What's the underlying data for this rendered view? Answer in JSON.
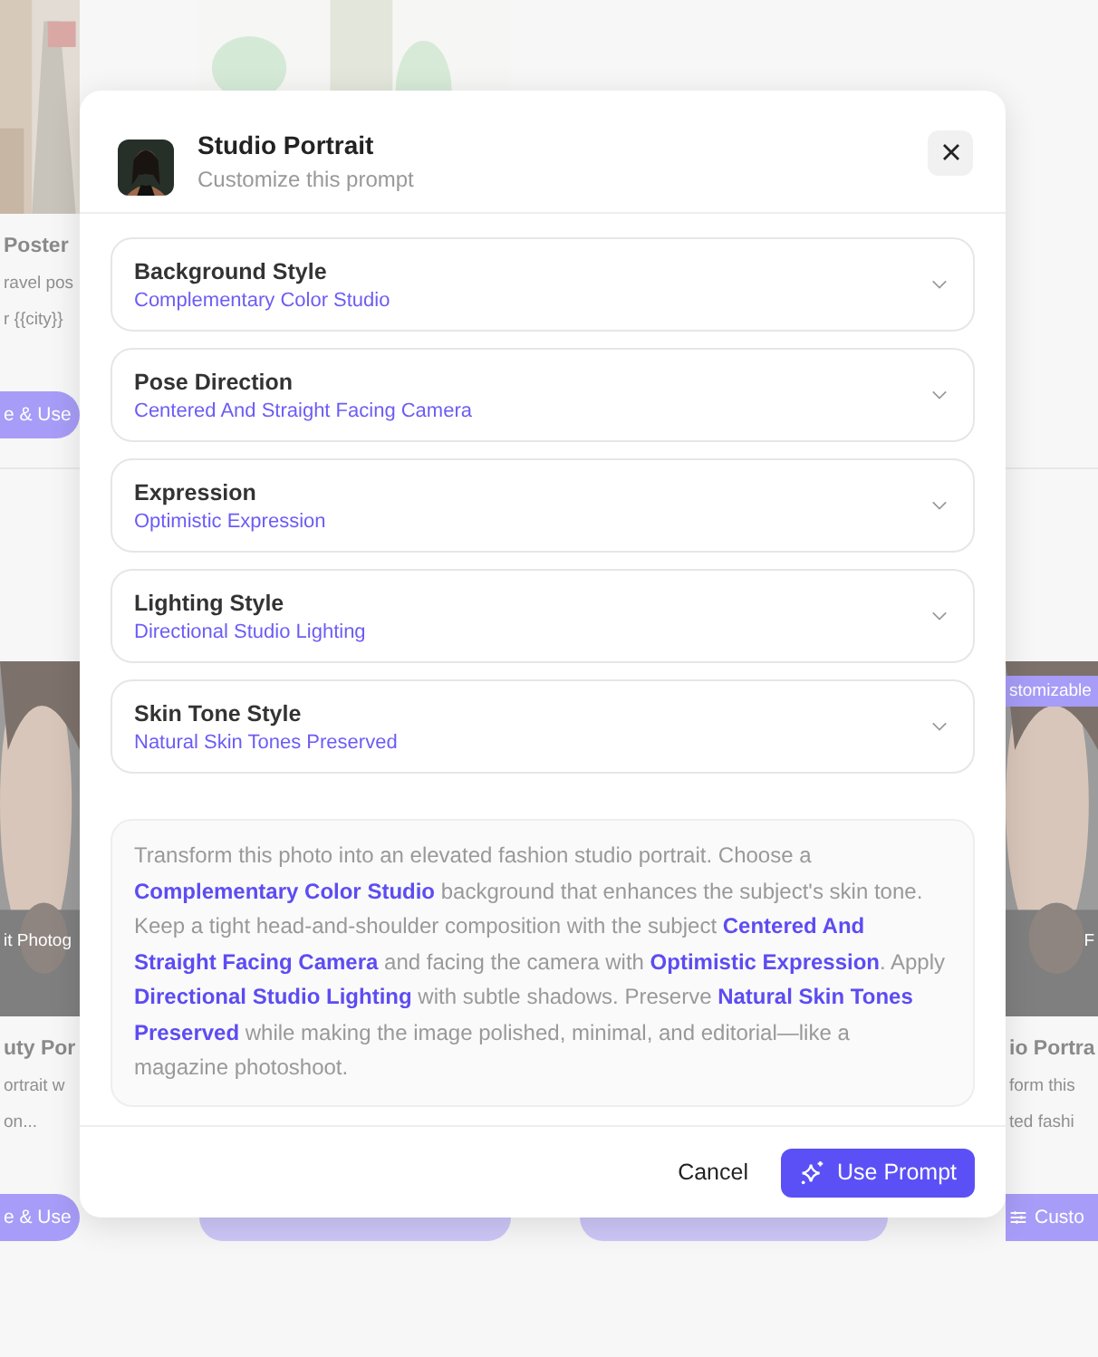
{
  "gallery": {
    "rows": [
      {
        "cards": [
          {
            "kind": "picture",
            "title": "Poster",
            "desc_lines": [
              "ravel pos",
              "r {{city}}"
            ],
            "button": "e & Use"
          },
          {
            "kind": "picture"
          },
          {
            "kind": "plain"
          },
          {
            "kind": "plain"
          }
        ]
      },
      {
        "cards": [
          {
            "kind": "picture",
            "caption": "it Photog",
            "title": "uty Por",
            "desc_lines": [
              "ortrait w",
              "on..."
            ],
            "button": "e & Use"
          },
          {
            "kind": "plain"
          },
          {
            "kind": "plain"
          },
          {
            "kind": "picture",
            "caption": "F",
            "badge": "stomizable",
            "title": "io Portra",
            "desc_lines": [
              "form this",
              "ted fashi"
            ],
            "button": "Custo",
            "button_icon": true
          }
        ]
      }
    ]
  },
  "dialog": {
    "title": "Studio Portrait",
    "subtitle": "Customize this prompt",
    "options": [
      {
        "label": "Background Style",
        "value": "Complementary Color Studio"
      },
      {
        "label": "Pose Direction",
        "value": "Centered And Straight Facing Camera"
      },
      {
        "label": "Expression",
        "value": "Optimistic Expression"
      },
      {
        "label": "Lighting Style",
        "value": "Directional Studio Lighting"
      },
      {
        "label": "Skin Tone Style",
        "value": "Natural Skin Tones Preserved"
      }
    ],
    "prompt": "Transform this photo into an elevated fashion studio portrait. Choose a **Complementary Color Studio** background that enhances the subject's skin tone. Keep a tight head-and-shoulder composition with the subject **Centered And Straight Facing Camera** and facing the camera with **Optimistic Expression**. Apply **Directional Studio Lighting** with subtle shadows. Preserve **Natural Skin Tones Preserved** while making the image polished, minimal, and editorial—like a magazine photoshoot.",
    "cancel": "Cancel",
    "confirm": "Use Prompt"
  }
}
